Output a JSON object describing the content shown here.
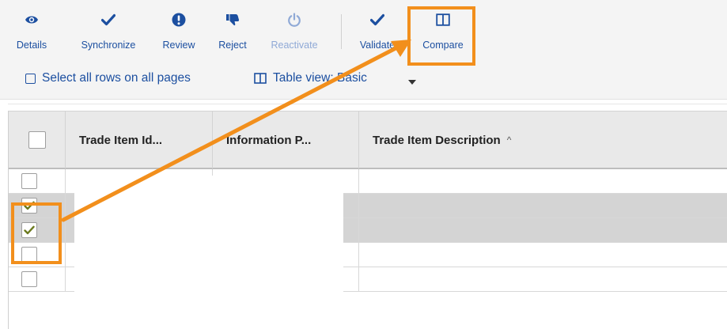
{
  "toolbar": {
    "buttons": [
      {
        "label": "Details",
        "icon": "eye-icon"
      },
      {
        "label": "Synchronize",
        "icon": "checkmark-icon"
      },
      {
        "label": "Review",
        "icon": "exclamation-icon"
      },
      {
        "label": "Reject",
        "icon": "thumbs-down-icon"
      },
      {
        "label": "Reactivate",
        "icon": "power-icon",
        "disabled": true
      },
      {
        "label": "Validate",
        "icon": "checkmark-icon"
      },
      {
        "label": "Compare",
        "icon": "columns-icon"
      }
    ]
  },
  "options": {
    "select_all_label": "Select all rows on all pages",
    "table_view_label": "Table view: Basic"
  },
  "table": {
    "columns": [
      "",
      "Trade Item Id...",
      "Information P...",
      "Trade Item Description"
    ],
    "sorted_column_indicator": "^",
    "rows": [
      {
        "checked": false
      },
      {
        "checked": true
      },
      {
        "checked": true
      },
      {
        "checked": false
      },
      {
        "checked": false
      }
    ]
  },
  "colors": {
    "accent_blue": "#1c4fa0",
    "disabled_blue": "#8fa9d6",
    "annotation_orange": "#f28f1c",
    "check_olive": "#6b7a1e",
    "selected_row": "#d4d4d4"
  }
}
